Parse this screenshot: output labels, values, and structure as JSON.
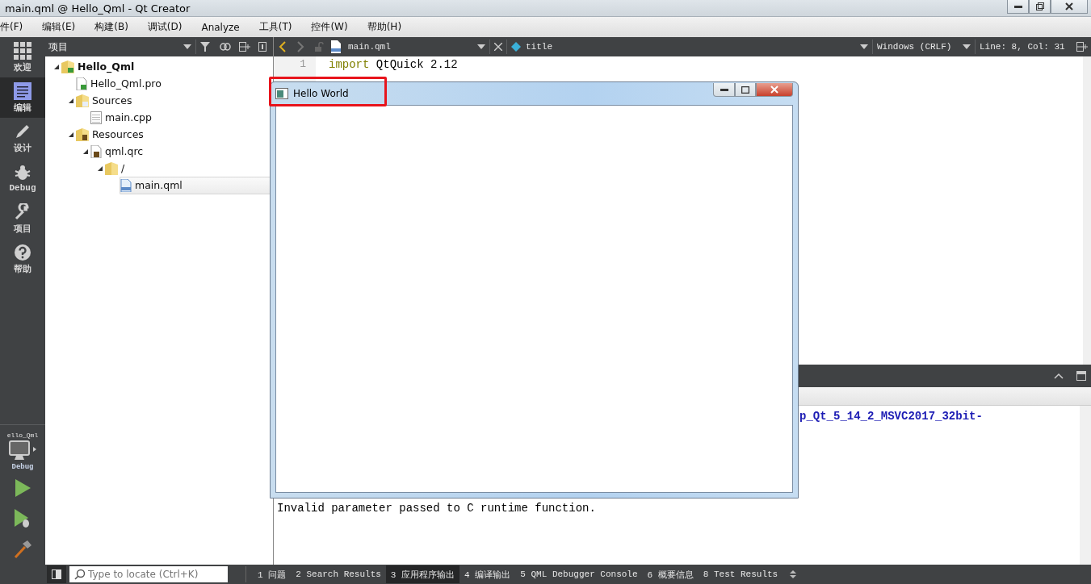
{
  "window": {
    "title": "main.qml @ Hello_Qml - Qt Creator"
  },
  "menu": [
    "件(F)",
    "编辑(E)",
    "构建(B)",
    "调试(D)",
    "Analyze",
    "工具(T)",
    "控件(W)",
    "帮助(H)"
  ],
  "modes": [
    {
      "kind": "grid",
      "label": "欢迎",
      "selected": false
    },
    {
      "kind": "edit",
      "label": "编辑",
      "selected": true
    },
    {
      "kind": "pen",
      "label": "设计",
      "selected": false
    },
    {
      "kind": "bug",
      "label": "Debug",
      "selected": false
    },
    {
      "kind": "wrench",
      "label": "项目",
      "selected": false
    },
    {
      "kind": "help",
      "label": "帮助",
      "selected": false
    }
  ],
  "kit": {
    "project": "ello_Qml",
    "config": "Debug"
  },
  "project_panel": {
    "title": "项目",
    "tree": [
      {
        "label": "Hello_Qml",
        "kind": "project",
        "expanded": true,
        "selected": false,
        "children": [
          {
            "label": "Hello_Qml.pro",
            "kind": "pro",
            "selected": false
          },
          {
            "label": "Sources",
            "kind": "folder-cpp",
            "expanded": true,
            "selected": false,
            "children": [
              {
                "label": "main.cpp",
                "kind": "file",
                "selected": false
              }
            ]
          },
          {
            "label": "Resources",
            "kind": "folder-res",
            "expanded": true,
            "selected": false,
            "children": [
              {
                "label": "qml.qrc",
                "kind": "qrc",
                "expanded": true,
                "selected": false,
                "children": [
                  {
                    "label": "/",
                    "kind": "folder",
                    "expanded": true,
                    "selected": false,
                    "children": [
                      {
                        "label": "main.qml",
                        "kind": "qml",
                        "selected": true
                      }
                    ]
                  }
                ]
              }
            ]
          }
        ]
      }
    ]
  },
  "editor": {
    "file": "main.qml",
    "symbol": "title",
    "line_ending": "Windows (CRLF)",
    "position": "Line: 8, Col: 31",
    "lines": [
      {
        "number": "1",
        "keyword": "import",
        "text": " QtQuick 2.12"
      }
    ]
  },
  "app_window": {
    "title": "Hello World"
  },
  "output": {
    "lines": [
      {
        "kind": "link",
        "text": "p_Qt_5_14_2_MSVC2017_32bit-"
      },
      {
        "kind": "plain",
        "text": "Invalid parameter passed to C runtime function."
      }
    ]
  },
  "locator": {
    "placeholder": "Type to locate (Ctrl+K)"
  },
  "panes": [
    {
      "number": "1",
      "label": "问题",
      "selected": false
    },
    {
      "number": "2",
      "label": "Search Results",
      "selected": false
    },
    {
      "number": "3",
      "label": "应用程序输出",
      "selected": true
    },
    {
      "number": "4",
      "label": "编译输出",
      "selected": false
    },
    {
      "number": "5",
      "label": "QML Debugger Console",
      "selected": false
    },
    {
      "number": "6",
      "label": "概要信息",
      "selected": false
    },
    {
      "number": "8",
      "label": "Test Results",
      "selected": false
    }
  ]
}
